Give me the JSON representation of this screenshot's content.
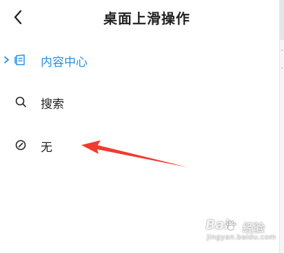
{
  "header": {
    "title": "桌面上滑操作",
    "back_icon": "chevron-left-icon"
  },
  "options": [
    {
      "label": "内容中心",
      "icon": "content-center-icon",
      "selected": true
    },
    {
      "label": "搜索",
      "icon": "search-icon",
      "selected": false
    },
    {
      "label": "无",
      "icon": "none-icon",
      "selected": false
    }
  ],
  "colors": {
    "accent": "#2a8fe0",
    "text": "#222222",
    "annotation_arrow": "#f23a2e"
  },
  "watermark": {
    "brand": "Bai",
    "brand_cn": "经验",
    "url": "jingyan.baidu.com"
  }
}
